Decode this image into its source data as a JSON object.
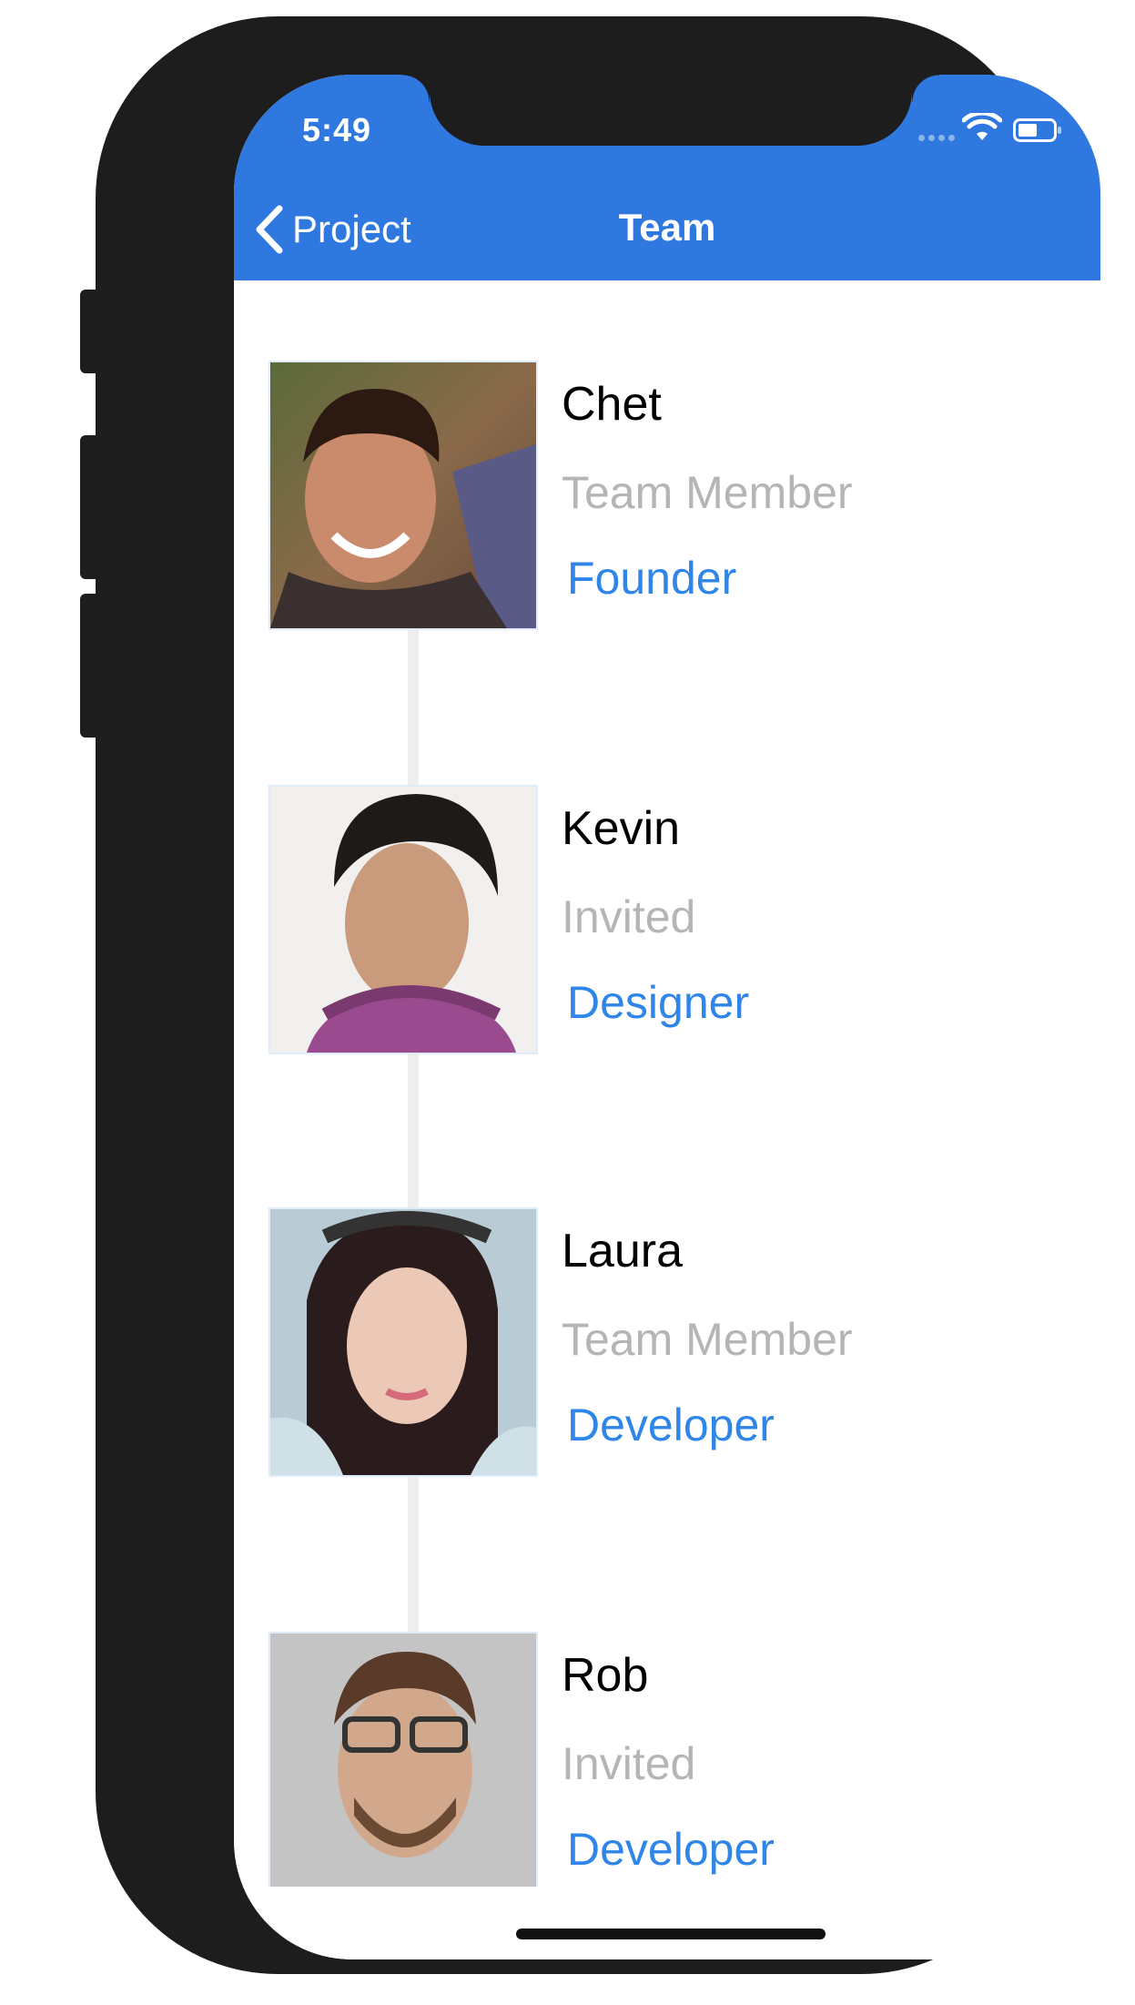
{
  "status_bar": {
    "time": "5:49"
  },
  "nav": {
    "back_label": "Project",
    "title": "Team"
  },
  "colors": {
    "nav_bar": "#2f78e0",
    "role_text": "#2f86e8",
    "status_text": "#b5b5b5"
  },
  "members": [
    {
      "name": "Chet",
      "status": "Team Member",
      "role": "Founder"
    },
    {
      "name": "Kevin",
      "status": "Invited",
      "role": "Designer"
    },
    {
      "name": "Laura",
      "status": "Team Member",
      "role": "Developer"
    },
    {
      "name": "Rob",
      "status": "Invited",
      "role": "Developer"
    }
  ]
}
